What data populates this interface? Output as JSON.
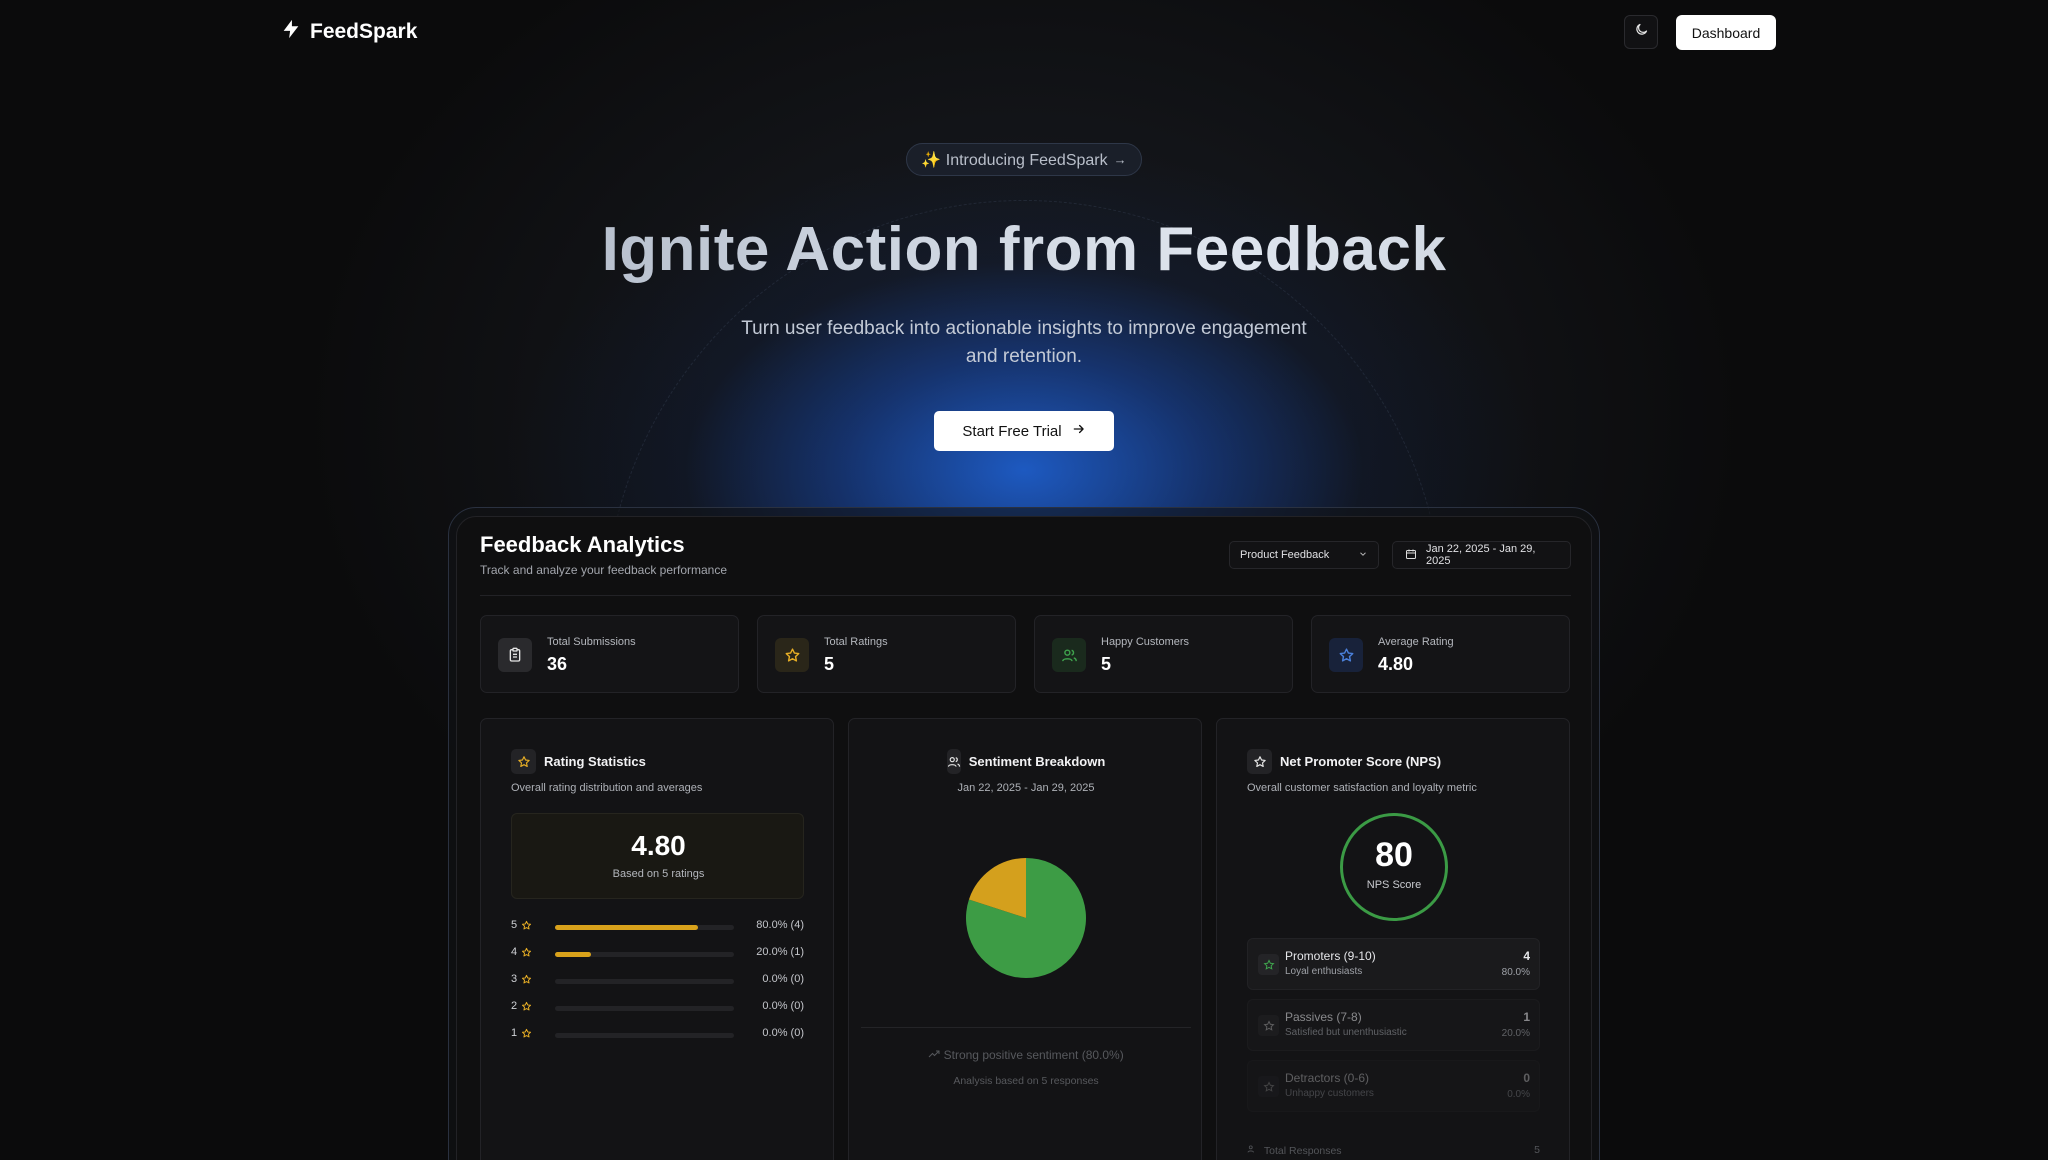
{
  "nav": {
    "brand": "FeedSpark",
    "dashboard_label": "Dashboard"
  },
  "hero": {
    "pill_label": "✨ Introducing FeedSpark",
    "title": "Ignite Action from Feedback",
    "subtitle": "Turn user feedback into actionable insights to improve engagement and retention.",
    "cta_label": "Start Free Trial"
  },
  "dashboard": {
    "title": "Feedback Analytics",
    "subtitle": "Track and analyze your feedback performance",
    "form_select": "Product Feedback",
    "date_range": "Jan 22, 2025 - Jan 29, 2025",
    "stats": [
      {
        "label": "Total Submissions",
        "value": "36",
        "icon": "clipboard-icon",
        "color": "#e5e5e5"
      },
      {
        "label": "Total Ratings",
        "value": "5",
        "icon": "star-icon",
        "color": "#e6ad25"
      },
      {
        "label": "Happy Customers",
        "value": "5",
        "icon": "users-icon",
        "color": "#3fa34d"
      },
      {
        "label": "Average Rating",
        "value": "4.80",
        "icon": "star-icon",
        "color": "#4a7fd9"
      }
    ]
  },
  "rating_stats": {
    "title": "Rating Statistics",
    "subtitle": "Overall rating distribution and averages",
    "average": "4.80",
    "based_on": "Based on 5 ratings",
    "distribution": [
      {
        "stars": "5",
        "fraction": 0.8,
        "label": "80.0% (4)"
      },
      {
        "stars": "4",
        "fraction": 0.2,
        "label": "20.0% (1)"
      },
      {
        "stars": "3",
        "fraction": 0.0,
        "label": "0.0% (0)"
      },
      {
        "stars": "2",
        "fraction": 0.0,
        "label": "0.0% (0)"
      },
      {
        "stars": "1",
        "fraction": 0.0,
        "label": "0.0% (0)"
      }
    ],
    "accent": "#d9a21b"
  },
  "sentiment": {
    "title": "Sentiment Breakdown",
    "date_range": "Jan 22, 2025 - Jan 29, 2025",
    "summary": "Strong positive sentiment (80.0%)",
    "basis": "Analysis based on 5 responses",
    "slices": [
      {
        "value": 80,
        "color": "#3d9c45"
      },
      {
        "value": 20,
        "color": "#d4a01d"
      }
    ]
  },
  "nps": {
    "title": "Net Promoter Score (NPS)",
    "subtitle": "Overall customer satisfaction and loyalty metric",
    "score": "80",
    "score_label": "NPS Score",
    "ring_color": "#3b9b45",
    "rows": [
      {
        "label": "Promoters (9-10)",
        "sub": "Loyal enthusiasts",
        "count": "4",
        "pct": "80.0%"
      },
      {
        "label": "Passives (7-8)",
        "sub": "Satisfied but unenthusiastic",
        "count": "1",
        "pct": "20.0%"
      },
      {
        "label": "Detractors (0-6)",
        "sub": "Unhappy customers",
        "count": "0",
        "pct": "0.0%"
      }
    ],
    "total_label": "Total Responses",
    "total_value": "5"
  }
}
